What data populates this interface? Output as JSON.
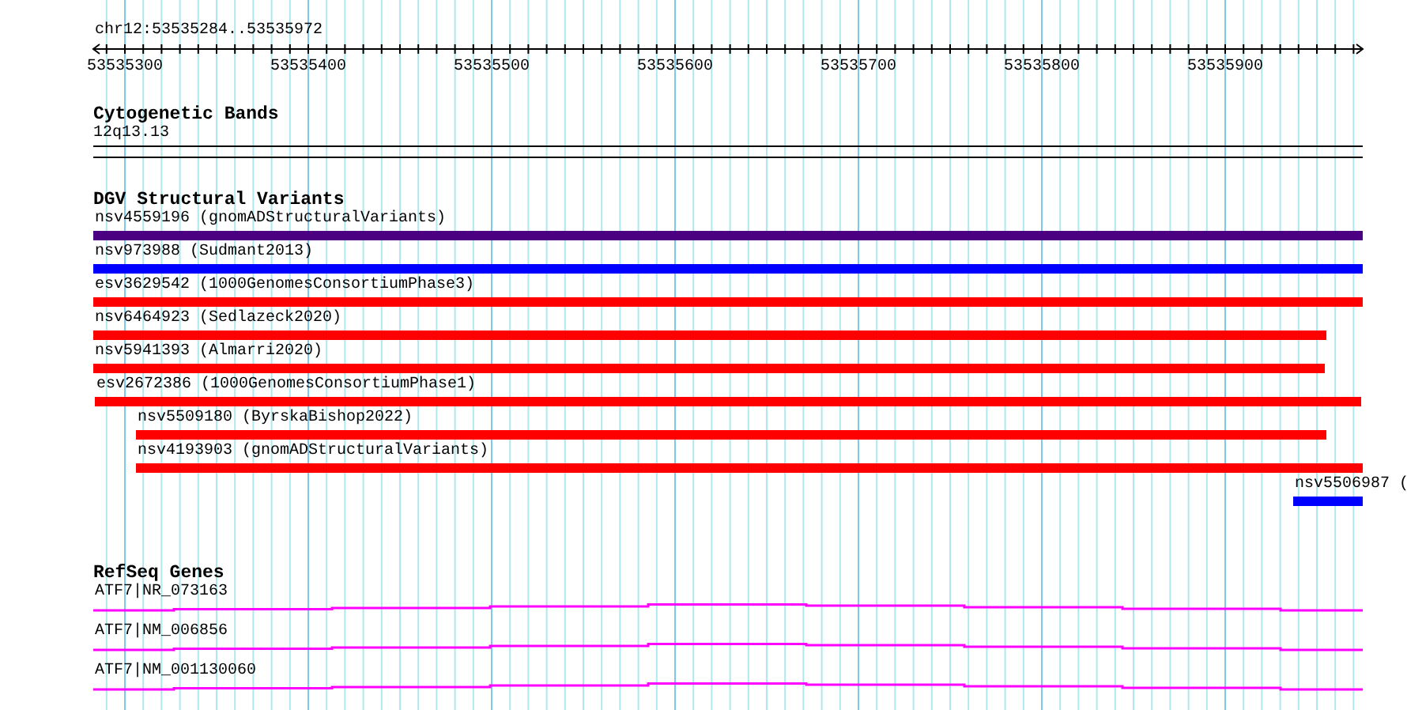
{
  "ruler": {
    "location": "chr12:53535284..53535972",
    "ticks": [
      "53535300",
      "53535400",
      "53535500",
      "53535600",
      "53535700",
      "53535800",
      "53535900"
    ]
  },
  "tracks": [
    {
      "kind": "bands",
      "title": "Cytogenetic Bands",
      "features": [
        {
          "label": "12q13.13"
        }
      ]
    },
    {
      "kind": "variants",
      "title": "DGV Structural Variants",
      "features": [
        {
          "label": "nsv4559196 (gnomADStructuralVariants)",
          "color": "#4b0082"
        },
        {
          "label": "nsv973988 (Sudmant2013)",
          "color": "#0000ff"
        },
        {
          "label": "esv3629542 (1000GenomesConsortiumPhase3)",
          "color": "#ff0000"
        },
        {
          "label": "nsv6464923 (Sedlazeck2020)",
          "color": "#ff0000"
        },
        {
          "label": "nsv5941393 (Almarri2020)",
          "color": "#ff0000"
        },
        {
          "label": "esv2672386 (1000GenomesConsortiumPhase1)",
          "color": "#ff0000"
        },
        {
          "label": "nsv5509180 (ByrskaBishop2022)",
          "color": "#ff0000"
        },
        {
          "label": "nsv4193903 (gnomADStructuralVariants)",
          "color": "#ff0000"
        },
        {
          "label": "nsv5506987 (",
          "color": "#0000ff"
        }
      ]
    },
    {
      "kind": "genes",
      "title": "RefSeq Genes",
      "features": [
        {
          "label": "ATF7|NR_073163"
        },
        {
          "label": "ATF7|NM_006856"
        },
        {
          "label": "ATF7|NM_001130060"
        }
      ]
    }
  ]
}
